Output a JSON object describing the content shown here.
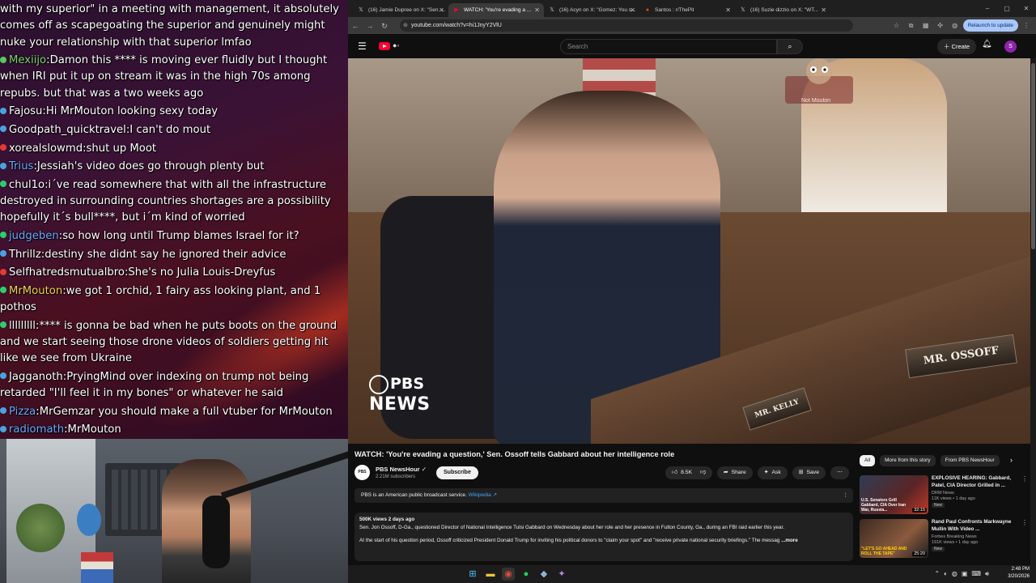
{
  "chat": {
    "messages": [
      {
        "user": "",
        "color": "#ffffff",
        "badge": "",
        "text": "with my superior\" in a meeting with management, it absolutely comes off as scapegoating the superior and genuinely might nuke your relationship with that superior lmfao"
      },
      {
        "user": "Mexiijo",
        "color": "#7cd36a",
        "badge": "#58c85f",
        "text": "Damon this **** is moving ever fluidly but I thought when IRI put it up on stream it was in the high 70s among repubs. but that was a two weeks ago"
      },
      {
        "user": "Fajosu",
        "color": "#ffffff",
        "badge": "#4aa3df",
        "text": "Hi MrMouton looking sexy today"
      },
      {
        "user": "Goodpath_quicktravel",
        "color": "#ffffff",
        "badge": "#4aa3df",
        "text": "I can't do mout"
      },
      {
        "user": "xorealslowmd",
        "color": "#ffffff",
        "badge": "#e53935",
        "text": "shut up Moot"
      },
      {
        "user": "Trius",
        "color": "#69a7ff",
        "badge": "#4aa3df",
        "text": "Jessiah's video does go through plenty but"
      },
      {
        "user": "chul1o",
        "color": "#ffffff",
        "badge": "#2ecc71",
        "text": "i´ve read somewhere that with all the infrastructure destroyed in surrounding countries shortages are a possibility hopefully it´s bull****, but i´m kind of worried"
      },
      {
        "user": "judgeben",
        "color": "#69a7ff",
        "badge": "#2ecc71",
        "text": "so how long until Trump blames Israel for it?"
      },
      {
        "user": "Thrillz",
        "color": "#ffffff",
        "badge": "#4aa3df",
        "text": "destiny she didnt say he ignored their advice"
      },
      {
        "user": "Selfhatredsmutualbro",
        "color": "#ffffff",
        "badge": "#e53935",
        "text": "She's no Julia Louis-Dreyfus"
      },
      {
        "user": "MrMouton",
        "color": "#f5d24a",
        "badge": "#2ecc71",
        "text": "we got 1 orchid, 1 fairy ass looking plant, and 1 pothos"
      },
      {
        "user": "lllllllll",
        "color": "#ffffff",
        "badge": "#2ecc71",
        "text": "**** is gonna be bad when he puts boots on the ground and we start seeing those drone videos of soldiers getting hit like we see from Ukraine"
      },
      {
        "user": "Jagganoth",
        "color": "#ffffff",
        "badge": "#4aa3df",
        "text": "PryingMind over indexing on trump not being retarded \"I'll feel it in my bones\" or whatever he said"
      },
      {
        "user": "Pizza",
        "color": "#69a7ff",
        "badge": "#4aa3df",
        "text": "MrGemzar you should make a full vtuber for MrMouton"
      },
      {
        "user": "radiomath",
        "color": "#69a7ff",
        "badge": "#4aa3df",
        "text": "MrMouton"
      }
    ]
  },
  "browser": {
    "tabs": [
      {
        "title": "(16) Jamie Dupree on X: \"Sen. ...",
        "icon": "x-icon",
        "active": false
      },
      {
        "title": "WATCH: 'You're evading a ...",
        "icon": "youtube-icon",
        "active": true
      },
      {
        "title": "(16) Acyn on X: \"Gomez: You s...",
        "icon": "x-icon",
        "active": false
      },
      {
        "title": "Santos : r/ThePit",
        "icon": "reddit-icon",
        "active": false
      },
      {
        "title": "(16) Suzie dizzio on X: \"WT...",
        "icon": "x-icon",
        "active": false
      }
    ],
    "url": "youtube.com/watch?v=hi1JnyY2VlU",
    "relaunch_label": "Relaunch to update",
    "window_controls": [
      "–",
      "▢",
      "✕"
    ]
  },
  "youtube": {
    "search_placeholder": "Search",
    "create_label": "Create",
    "avatar_letter": "S",
    "video": {
      "title": "WATCH: 'You're evading a question,' Sen. Ossoff tells Gabbard about her intelligence role",
      "channel": "PBS NewsHour",
      "subscribers": "2.21M subscribers",
      "subscribe_label": "Subscribe",
      "likes": "8.5K",
      "share_label": "Share",
      "ask_label": "Ask",
      "save_label": "Save",
      "watermark_top": "PBS",
      "watermark_bottom": "NEWS",
      "nameplate_1": "MR. OSSOFF",
      "nameplate_2": "MR. KELLY",
      "overlay_label": "Not Mouton"
    },
    "info_panel": {
      "text": "PBS is an American public broadcast service.",
      "link": "Wikipedia ↗"
    },
    "description": {
      "meta": "500K views  2 days ago",
      "line1": "Sen. Jon Ossoff, D-Ga., questioned Director of National Intelligence Tulsi Gabbard on Wednesday about her role and her presence in Fulton County, Ga., during an FBI raid earlier this year.",
      "line2": "At the start of his question period, Ossoff criticized President Donald Trump for inviting his political donors to \"claim your spot\" and \"receive private national security briefings.\" The messag",
      "more": "...more"
    },
    "chips": [
      "All",
      "More from this story",
      "From PBS NewsHour"
    ],
    "recommendations": [
      {
        "title": "EXPLOSIVE HEARING: Gabbard, Patel, CIA Director Grilled in ...",
        "channel": "DRM News",
        "meta": "11K views • 1 day ago",
        "badge": "New",
        "duration": "32:15",
        "thumb_text": "U.S. Senators Grill Gabbard, CIA Over Iran War, Russia..."
      },
      {
        "title": "Rand Paul Confronts Markwayne Mullin With Video ...",
        "channel": "Forbes Breaking News",
        "meta": "191K views • 1 day ago",
        "badge": "New",
        "duration": "25:20",
        "thumb_text": "\"LET'S GO AHEAD AND ROLL THE TAPE\""
      }
    ]
  },
  "taskbar": {
    "time": "2:48 PM",
    "date": "3/20/2026"
  }
}
